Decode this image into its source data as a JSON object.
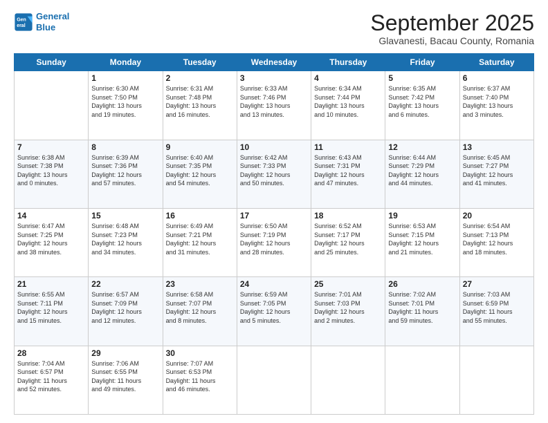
{
  "logo": {
    "line1": "General",
    "line2": "Blue"
  },
  "title": "September 2025",
  "subtitle": "Glavanesti, Bacau County, Romania",
  "days_of_week": [
    "Sunday",
    "Monday",
    "Tuesday",
    "Wednesday",
    "Thursday",
    "Friday",
    "Saturday"
  ],
  "weeks": [
    [
      {
        "day": "",
        "info": ""
      },
      {
        "day": "1",
        "info": "Sunrise: 6:30 AM\nSunset: 7:50 PM\nDaylight: 13 hours\nand 19 minutes."
      },
      {
        "day": "2",
        "info": "Sunrise: 6:31 AM\nSunset: 7:48 PM\nDaylight: 13 hours\nand 16 minutes."
      },
      {
        "day": "3",
        "info": "Sunrise: 6:33 AM\nSunset: 7:46 PM\nDaylight: 13 hours\nand 13 minutes."
      },
      {
        "day": "4",
        "info": "Sunrise: 6:34 AM\nSunset: 7:44 PM\nDaylight: 13 hours\nand 10 minutes."
      },
      {
        "day": "5",
        "info": "Sunrise: 6:35 AM\nSunset: 7:42 PM\nDaylight: 13 hours\nand 6 minutes."
      },
      {
        "day": "6",
        "info": "Sunrise: 6:37 AM\nSunset: 7:40 PM\nDaylight: 13 hours\nand 3 minutes."
      }
    ],
    [
      {
        "day": "7",
        "info": "Sunrise: 6:38 AM\nSunset: 7:38 PM\nDaylight: 13 hours\nand 0 minutes."
      },
      {
        "day": "8",
        "info": "Sunrise: 6:39 AM\nSunset: 7:36 PM\nDaylight: 12 hours\nand 57 minutes."
      },
      {
        "day": "9",
        "info": "Sunrise: 6:40 AM\nSunset: 7:35 PM\nDaylight: 12 hours\nand 54 minutes."
      },
      {
        "day": "10",
        "info": "Sunrise: 6:42 AM\nSunset: 7:33 PM\nDaylight: 12 hours\nand 50 minutes."
      },
      {
        "day": "11",
        "info": "Sunrise: 6:43 AM\nSunset: 7:31 PM\nDaylight: 12 hours\nand 47 minutes."
      },
      {
        "day": "12",
        "info": "Sunrise: 6:44 AM\nSunset: 7:29 PM\nDaylight: 12 hours\nand 44 minutes."
      },
      {
        "day": "13",
        "info": "Sunrise: 6:45 AM\nSunset: 7:27 PM\nDaylight: 12 hours\nand 41 minutes."
      }
    ],
    [
      {
        "day": "14",
        "info": "Sunrise: 6:47 AM\nSunset: 7:25 PM\nDaylight: 12 hours\nand 38 minutes."
      },
      {
        "day": "15",
        "info": "Sunrise: 6:48 AM\nSunset: 7:23 PM\nDaylight: 12 hours\nand 34 minutes."
      },
      {
        "day": "16",
        "info": "Sunrise: 6:49 AM\nSunset: 7:21 PM\nDaylight: 12 hours\nand 31 minutes."
      },
      {
        "day": "17",
        "info": "Sunrise: 6:50 AM\nSunset: 7:19 PM\nDaylight: 12 hours\nand 28 minutes."
      },
      {
        "day": "18",
        "info": "Sunrise: 6:52 AM\nSunset: 7:17 PM\nDaylight: 12 hours\nand 25 minutes."
      },
      {
        "day": "19",
        "info": "Sunrise: 6:53 AM\nSunset: 7:15 PM\nDaylight: 12 hours\nand 21 minutes."
      },
      {
        "day": "20",
        "info": "Sunrise: 6:54 AM\nSunset: 7:13 PM\nDaylight: 12 hours\nand 18 minutes."
      }
    ],
    [
      {
        "day": "21",
        "info": "Sunrise: 6:55 AM\nSunset: 7:11 PM\nDaylight: 12 hours\nand 15 minutes."
      },
      {
        "day": "22",
        "info": "Sunrise: 6:57 AM\nSunset: 7:09 PM\nDaylight: 12 hours\nand 12 minutes."
      },
      {
        "day": "23",
        "info": "Sunrise: 6:58 AM\nSunset: 7:07 PM\nDaylight: 12 hours\nand 8 minutes."
      },
      {
        "day": "24",
        "info": "Sunrise: 6:59 AM\nSunset: 7:05 PM\nDaylight: 12 hours\nand 5 minutes."
      },
      {
        "day": "25",
        "info": "Sunrise: 7:01 AM\nSunset: 7:03 PM\nDaylight: 12 hours\nand 2 minutes."
      },
      {
        "day": "26",
        "info": "Sunrise: 7:02 AM\nSunset: 7:01 PM\nDaylight: 11 hours\nand 59 minutes."
      },
      {
        "day": "27",
        "info": "Sunrise: 7:03 AM\nSunset: 6:59 PM\nDaylight: 11 hours\nand 55 minutes."
      }
    ],
    [
      {
        "day": "28",
        "info": "Sunrise: 7:04 AM\nSunset: 6:57 PM\nDaylight: 11 hours\nand 52 minutes."
      },
      {
        "day": "29",
        "info": "Sunrise: 7:06 AM\nSunset: 6:55 PM\nDaylight: 11 hours\nand 49 minutes."
      },
      {
        "day": "30",
        "info": "Sunrise: 7:07 AM\nSunset: 6:53 PM\nDaylight: 11 hours\nand 46 minutes."
      },
      {
        "day": "",
        "info": ""
      },
      {
        "day": "",
        "info": ""
      },
      {
        "day": "",
        "info": ""
      },
      {
        "day": "",
        "info": ""
      }
    ]
  ]
}
